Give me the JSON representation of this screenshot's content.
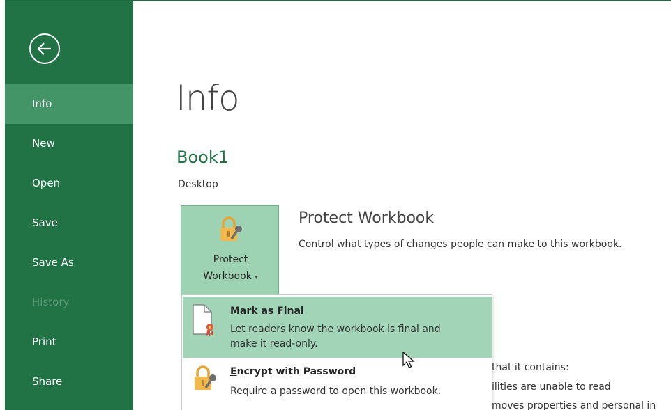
{
  "sidebar": {
    "items": [
      {
        "label": "Info",
        "state": "active"
      },
      {
        "label": "New",
        "state": "normal"
      },
      {
        "label": "Open",
        "state": "normal"
      },
      {
        "label": "Save",
        "state": "normal"
      },
      {
        "label": "Save As",
        "state": "normal"
      },
      {
        "label": "History",
        "state": "disabled"
      },
      {
        "label": "Print",
        "state": "normal"
      },
      {
        "label": "Share",
        "state": "normal"
      }
    ]
  },
  "main": {
    "title": "Info",
    "document_name": "Book1",
    "document_location": "Desktop",
    "protect": {
      "button_line1": "Protect",
      "button_line2": "Workbook",
      "heading": "Protect Workbook",
      "description": "Control what types of changes people can make to this workbook."
    },
    "background_lines": [
      "that it contains:",
      "ilities are unable to read",
      "moves properties and personal in"
    ]
  },
  "menu": {
    "mark_final": {
      "title_prefix": "Mark as ",
      "title_accel": "F",
      "title_suffix": "inal",
      "desc_line1": "Let readers know the workbook is final and",
      "desc_line2": "make it read-only."
    },
    "encrypt": {
      "title_accel": "E",
      "title_suffix": "ncrypt with Password",
      "desc": "Require a password to open this workbook."
    }
  },
  "colors": {
    "brand": "#217346",
    "sidebar_active": "#439467",
    "menu_hover": "#a2d5b7"
  }
}
